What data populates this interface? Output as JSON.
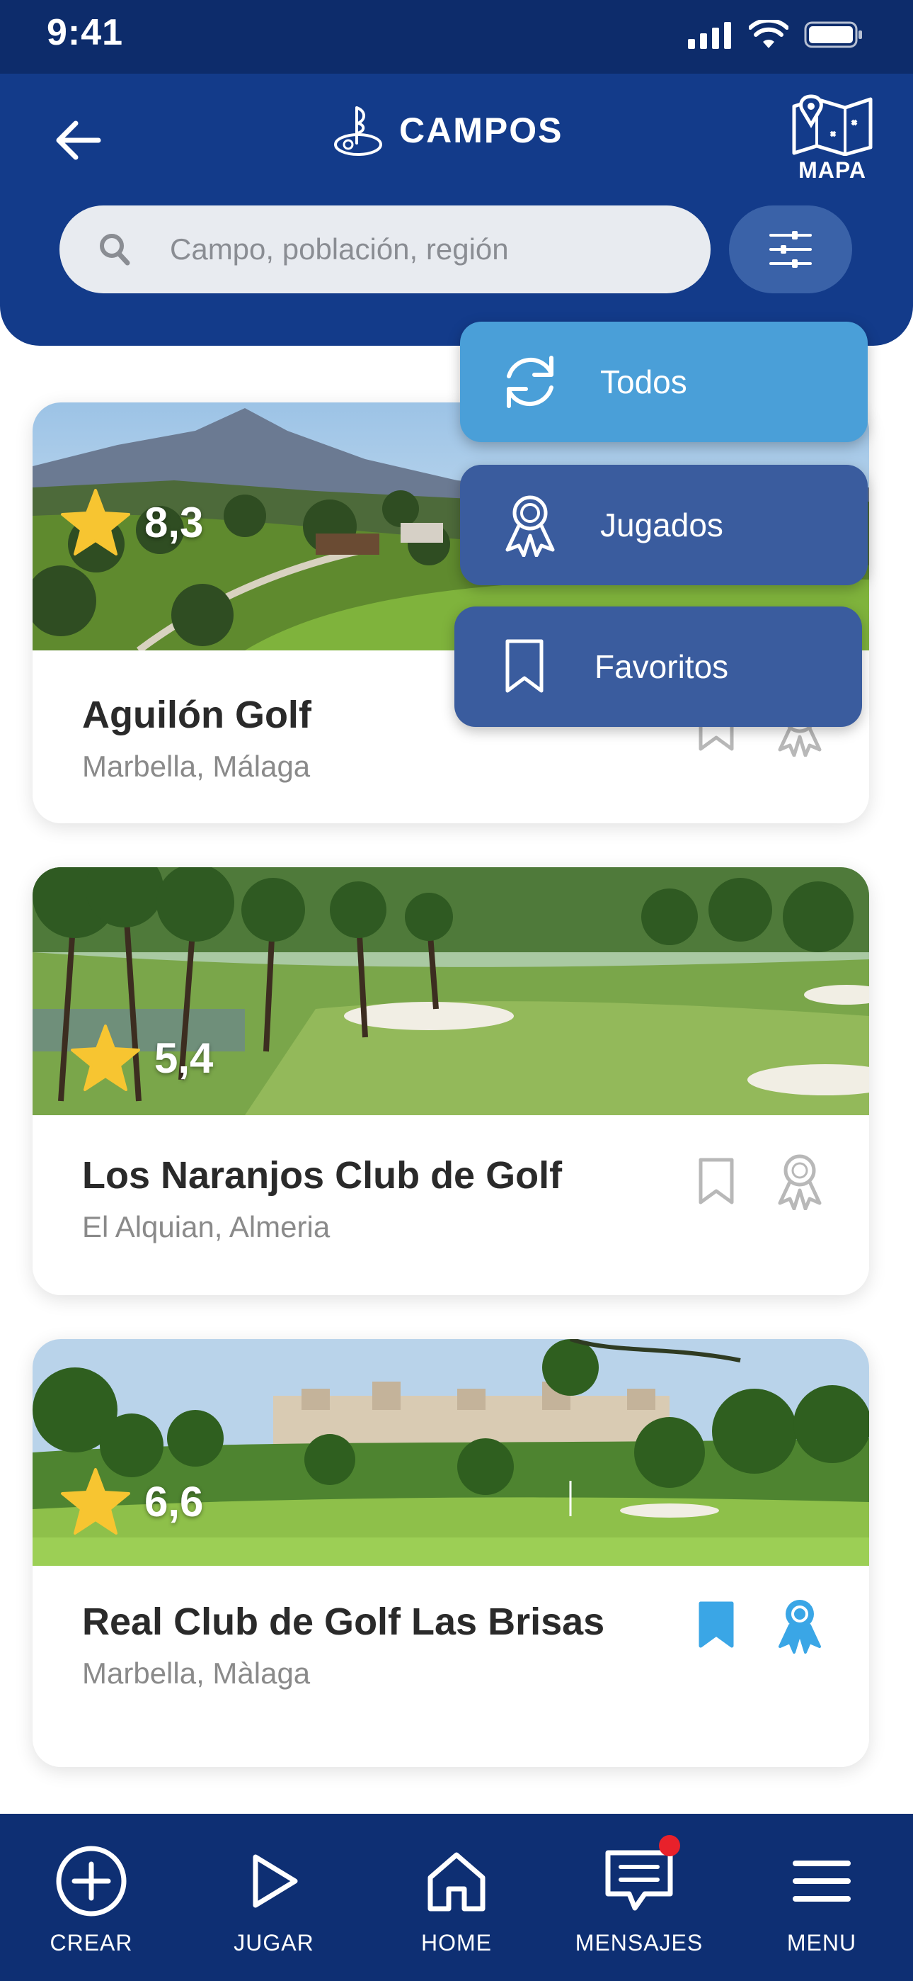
{
  "status_bar": {
    "time": "9:41"
  },
  "header": {
    "title": "CAMPOS",
    "map_label": "MAPA"
  },
  "search": {
    "placeholder": "Campo, población, región"
  },
  "filter_menu": {
    "items": [
      {
        "label": "Todos",
        "icon": "refresh-icon",
        "active": true
      },
      {
        "label": "Jugados",
        "icon": "medal-icon",
        "active": false
      },
      {
        "label": "Favoritos",
        "icon": "bookmark-icon",
        "active": false
      }
    ]
  },
  "courses": [
    {
      "name": "Aguilón Golf",
      "location": "Marbella, Málaga",
      "rating": "8,3",
      "favorite": false,
      "played": false
    },
    {
      "name": "Los Naranjos Club de Golf",
      "location": "El Alquian, Almeria",
      "rating": "5,4",
      "favorite": false,
      "played": false
    },
    {
      "name": "Real Club de Golf Las Brisas",
      "location": "Marbella, Màlaga",
      "rating": "6,6",
      "favorite": true,
      "played": true
    }
  ],
  "bottom_nav": {
    "items": [
      {
        "label": "CREAR",
        "icon": "plus-circle-icon"
      },
      {
        "label": "JUGAR",
        "icon": "play-icon"
      },
      {
        "label": "HOME",
        "icon": "home-icon"
      },
      {
        "label": "MENSAJES",
        "icon": "message-icon",
        "notification": true
      },
      {
        "label": "MENU",
        "icon": "hamburger-icon"
      }
    ]
  },
  "colors": {
    "header_bg": "#133b8a",
    "nav_bg": "#0e2f73",
    "accent_active": "#4a9fd8",
    "accent_menu": "#3a5c9e",
    "star": "#f7c531",
    "favorite_blue": "#3aa6e6"
  }
}
